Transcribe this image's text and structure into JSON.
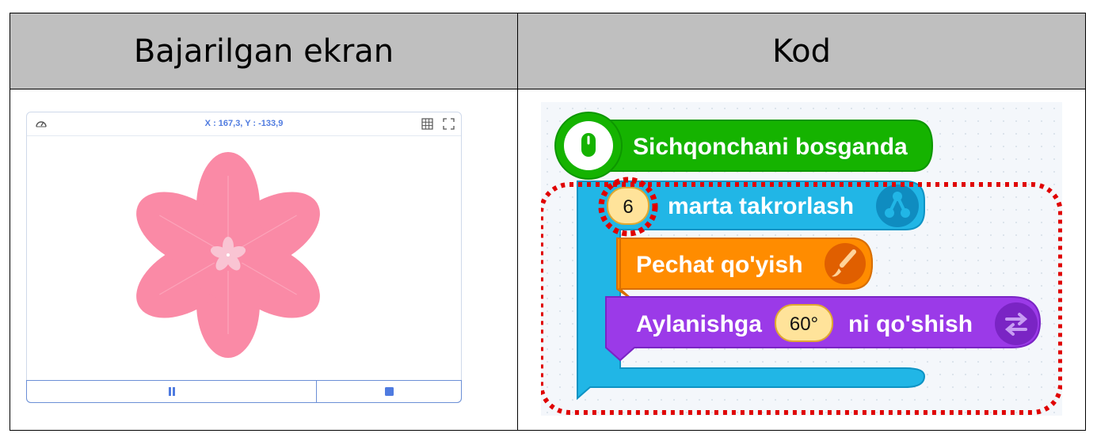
{
  "table": {
    "left_header": "Bajarilgan ekran",
    "right_header": "Kod"
  },
  "stage": {
    "coords_label": "X : 167,3, Y : -133,9",
    "icons": [
      "speed-icon",
      "grid-icon",
      "fullscreen-icon",
      "pause-icon",
      "stop-icon"
    ],
    "accent_color": "#4f7be0",
    "flower_color": "#fa8aa6"
  },
  "code": {
    "event_block": "Sichqonchani bosganda",
    "repeat_count": "6",
    "repeat_label": "marta takrorlash",
    "stamp_label": "Pechat qo'yish",
    "rotate_prefix": "Aylanishga",
    "rotate_value": "60°",
    "rotate_suffix": "ni qo'shish",
    "colors": {
      "event": "#15b300",
      "loop": "#21b6e6",
      "stamp": "#ff8c00",
      "rotate": "#9b3ae8",
      "highlight": "#e00000"
    }
  }
}
